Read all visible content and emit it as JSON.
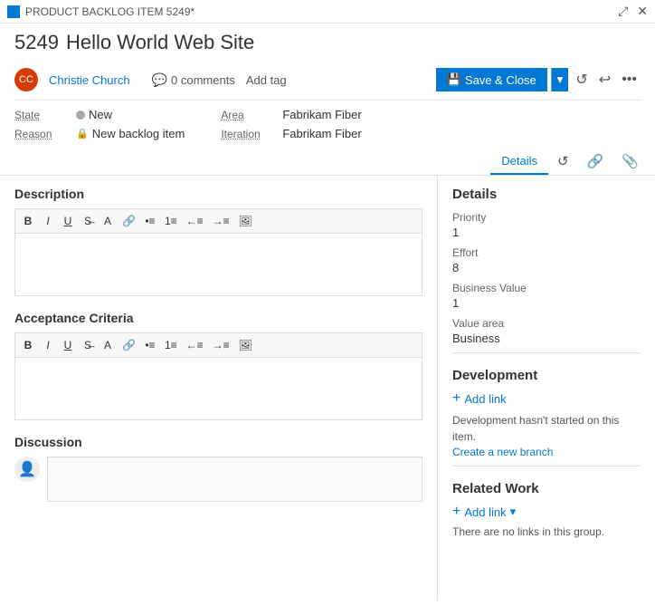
{
  "titleBar": {
    "label": "PRODUCT BACKLOG ITEM 5249*",
    "iconColor": "#0078d4",
    "expandIcon": "⤢",
    "closeIcon": "✕"
  },
  "header": {
    "itemId": "5249",
    "itemTitle": "Hello World Web Site"
  },
  "user": {
    "name": "Christie Church",
    "avatarText": "CC",
    "avatarBg": "#d83b01"
  },
  "comments": {
    "count": "0 comments"
  },
  "actions": {
    "addTag": "Add tag",
    "saveClose": "Save & Close",
    "saveIcon": "💾"
  },
  "meta": {
    "stateLabel": "State",
    "stateValue": "New",
    "reasonLabel": "Reason",
    "reasonValue": "New backlog item",
    "areaLabel": "Area",
    "areaValue": "Fabrikam Fiber",
    "iterationLabel": "Iteration",
    "iterationValue": "Fabrikam Fiber"
  },
  "tabs": [
    {
      "id": "details",
      "label": "Details",
      "active": true
    },
    {
      "id": "history",
      "label": "⟳",
      "isIcon": true
    },
    {
      "id": "links",
      "label": "🔗",
      "isIcon": true
    },
    {
      "id": "attachments",
      "label": "📎",
      "isIcon": true
    }
  ],
  "description": {
    "sectionTitle": "Description",
    "toolbar": [
      "B",
      "I",
      "U",
      "S̶",
      "A",
      "🔗",
      "•≡",
      "1≡",
      "←≡",
      "→≡",
      "🖼"
    ]
  },
  "acceptanceCriteria": {
    "sectionTitle": "Acceptance Criteria",
    "toolbar": [
      "B",
      "I",
      "U",
      "S̶",
      "A",
      "🔗",
      "•≡",
      "1≡",
      "←≡",
      "→≡",
      "🖼"
    ]
  },
  "discussion": {
    "sectionTitle": "Discussion"
  },
  "details": {
    "sectionTitle": "Details",
    "fields": [
      {
        "label": "Priority",
        "value": "1"
      },
      {
        "label": "Effort",
        "value": "8"
      },
      {
        "label": "Business Value",
        "value": "1"
      },
      {
        "label": "Value area",
        "value": "Business"
      }
    ]
  },
  "development": {
    "sectionTitle": "Development",
    "addLinkLabel": "+ Add link",
    "description": "Development hasn't started on this item.",
    "createBranchLabel": "Create a new branch"
  },
  "relatedWork": {
    "sectionTitle": "Related Work",
    "addLinkLabel": "Add link",
    "noLinksText": "There are no links in this group."
  }
}
